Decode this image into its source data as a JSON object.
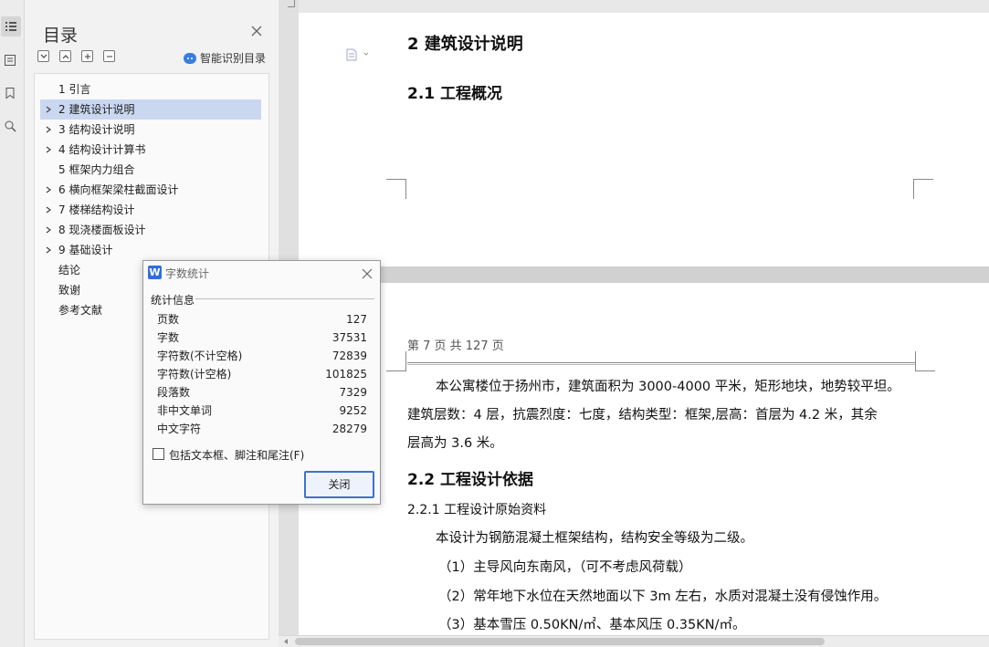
{
  "nav": {
    "title": "目录",
    "smart_label": "智能识别目录",
    "toc": [
      {
        "label": "1   引言",
        "expandable": false,
        "selected": false
      },
      {
        "label": "2   建筑设计说明",
        "expandable": true,
        "selected": true
      },
      {
        "label": "3   结构设计说明",
        "expandable": true,
        "selected": false
      },
      {
        "label": "4   结构设计计算书",
        "expandable": true,
        "selected": false
      },
      {
        "label": "5 框架内力组合",
        "expandable": false,
        "selected": false
      },
      {
        "label": "6  横向框架梁柱截面设计",
        "expandable": true,
        "selected": false
      },
      {
        "label": "7   楼梯结构设计",
        "expandable": true,
        "selected": false
      },
      {
        "label": "8   现浇楼面板设计",
        "expandable": true,
        "selected": false
      },
      {
        "label": "9   基础设计",
        "expandable": true,
        "selected": false
      },
      {
        "label": "结论",
        "expandable": false,
        "selected": false
      },
      {
        "label": "致谢",
        "expandable": false,
        "selected": false
      },
      {
        "label": "参考文献",
        "expandable": false,
        "selected": false
      }
    ]
  },
  "document": {
    "heading1": "2   建筑设计说明",
    "heading2_1": "2.1   工程概况",
    "header_text": "第 7 页  共 127 页",
    "para1_line1": "本公寓楼位于扬州市，建筑面积为 3000-4000 平米，矩形地块，地势较平坦。",
    "para1_line2": "建筑层数：4 层，抗震烈度：七度，结构类型：框架,层高：首层为 4.2 米，其余",
    "para1_line3": "层高为 3.6 米。",
    "heading2_2": "2.2   工程设计依据",
    "heading3": "2.2.1   工程设计原始资料",
    "para2": "本设计为钢筋混凝土框架结构，结构安全等级为二级。",
    "item1": "（1）主导风向东南风，（可不考虑风荷载）",
    "item2": "（2）常年地下水位在天然地面以下 3m 左右，水质对混凝土没有侵蚀作用。",
    "item3": "（3）基本雪压 0.50KN/㎡、基本风压 0.35KN/㎡。"
  },
  "dialog": {
    "logo": "W",
    "title": "字数统计",
    "section": "统计信息",
    "stats": [
      {
        "label": "页数",
        "value": "127"
      },
      {
        "label": "字数",
        "value": "37531"
      },
      {
        "label": "字符数(不计空格)",
        "value": "72839"
      },
      {
        "label": "字符数(计空格)",
        "value": "101825"
      },
      {
        "label": "段落数",
        "value": "7329"
      },
      {
        "label": "非中文单词",
        "value": "9252"
      },
      {
        "label": "中文字符",
        "value": "28279"
      }
    ],
    "checkbox_label": "包括文本框、脚注和尾注(F)",
    "close_label": "关闭"
  }
}
